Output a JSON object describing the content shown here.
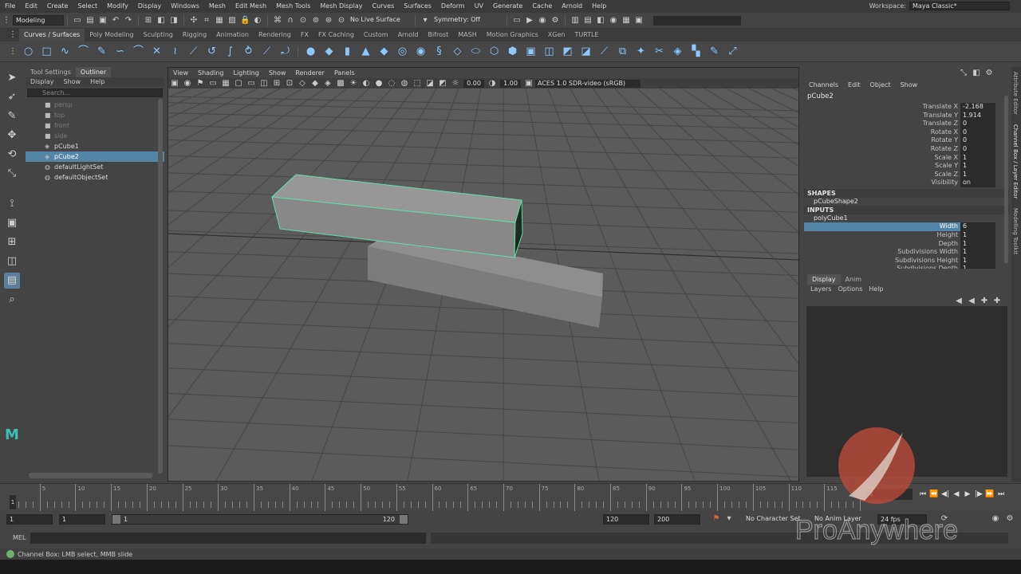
{
  "menubar": {
    "items": [
      "File",
      "Edit",
      "Create",
      "Select",
      "Modify",
      "Display",
      "Windows",
      "Mesh",
      "Edit Mesh",
      "Mesh Tools",
      "Mesh Display",
      "Curves",
      "Surfaces",
      "Deform",
      "UV",
      "Generate",
      "Cache",
      "Arnold",
      "Help"
    ],
    "workspace_label": "Workspace:",
    "workspace_value": "Maya Classic*"
  },
  "statusline": {
    "mode": "Modeling",
    "live_surface": "No Live Surface",
    "symmetry": "Symmetry: Off"
  },
  "shelf": {
    "tabs": [
      "Curves / Surfaces",
      "Poly Modeling",
      "Sculpting",
      "Rigging",
      "Animation",
      "Rendering",
      "FX",
      "FX Caching",
      "Custom",
      "Arnold",
      "Bifrost",
      "MASH",
      "Motion Graphics",
      "XGen",
      "TURTLE"
    ],
    "active_tab": "Curves / Surfaces"
  },
  "outliner": {
    "tabs": [
      "Tool Settings",
      "Outliner"
    ],
    "menu": [
      "Display",
      "Show",
      "Help"
    ],
    "search_placeholder": "Search...",
    "items": [
      {
        "label": "persp",
        "dim": true,
        "icon": "camera-icon"
      },
      {
        "label": "top",
        "dim": true,
        "icon": "camera-icon"
      },
      {
        "label": "front",
        "dim": true,
        "icon": "camera-icon"
      },
      {
        "label": "side",
        "dim": true,
        "icon": "camera-icon"
      },
      {
        "label": "pCube1",
        "dim": false,
        "icon": "mesh-icon"
      },
      {
        "label": "pCube2",
        "dim": false,
        "selected": true,
        "icon": "mesh-icon"
      },
      {
        "label": "defaultLightSet",
        "dim": false,
        "icon": "set-icon"
      },
      {
        "label": "defaultObjectSet",
        "dim": false,
        "icon": "set-icon"
      }
    ]
  },
  "viewport": {
    "menu": [
      "View",
      "Shading",
      "Lighting",
      "Show",
      "Renderer",
      "Panels"
    ],
    "near_value": "0.00",
    "far_value": "1.00",
    "color_management": "ACES 1.0 SDR-video (sRGB)"
  },
  "channelbox": {
    "menu": [
      "Channels",
      "Edit",
      "Object",
      "Show"
    ],
    "object_name": "pCube2",
    "attributes": [
      {
        "name": "Translate X",
        "value": "-2.168"
      },
      {
        "name": "Translate Y",
        "value": "1.914"
      },
      {
        "name": "Translate Z",
        "value": "0"
      },
      {
        "name": "Rotate X",
        "value": "0"
      },
      {
        "name": "Rotate Y",
        "value": "0"
      },
      {
        "name": "Rotate Z",
        "value": "0"
      },
      {
        "name": "Scale X",
        "value": "1"
      },
      {
        "name": "Scale Y",
        "value": "1"
      },
      {
        "name": "Scale Z",
        "value": "1"
      },
      {
        "name": "Visibility",
        "value": "on"
      }
    ],
    "shapes_header": "SHAPES",
    "shape_name": "pCubeShape2",
    "inputs_header": "INPUTS",
    "input_name": "polyCube1",
    "input_attributes": [
      {
        "name": "Width",
        "value": "6",
        "highlight": true
      },
      {
        "name": "Height",
        "value": "1"
      },
      {
        "name": "Depth",
        "value": "1"
      },
      {
        "name": "Subdivisions Width",
        "value": "1"
      },
      {
        "name": "Subdivisions Height",
        "value": "1"
      },
      {
        "name": "Subdivisions Depth",
        "value": "1"
      }
    ]
  },
  "layerbox": {
    "tabs": [
      "Display",
      "Anim"
    ],
    "menu": [
      "Layers",
      "Options",
      "Help"
    ]
  },
  "vertical_tabs": [
    "Attribute Editor",
    "Channel Box / Layer Editor",
    "Modelling Toolkit"
  ],
  "timeslider": {
    "labels": [
      "5",
      "10",
      "15",
      "20",
      "25",
      "30",
      "35",
      "40",
      "45",
      "50",
      "55",
      "60",
      "65",
      "70",
      "75",
      "80",
      "85",
      "90",
      "95",
      "100",
      "105",
      "110",
      "115",
      "120"
    ],
    "current_frame": "1"
  },
  "rangeslider": {
    "start": "1",
    "playback_start": "1",
    "range_start": "1",
    "range_end": "120",
    "playback_end": "120",
    "end": "200",
    "character_set": "No Character Set",
    "anim_layer": "No Anim Layer",
    "fps": "24 fps"
  },
  "cmdline": {
    "label": "MEL"
  },
  "helpline": {
    "text": "Channel Box: LMB select, MMB slide"
  },
  "watermark": {
    "text": "ProAnywhere"
  }
}
